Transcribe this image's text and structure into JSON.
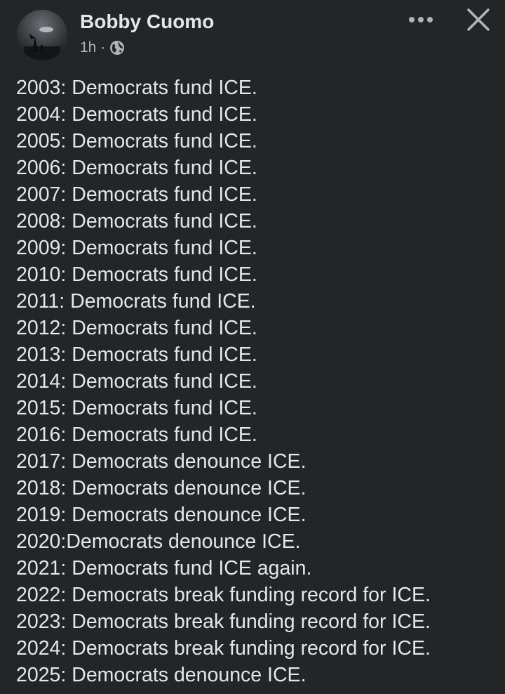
{
  "post": {
    "author": "Bobby Cuomo",
    "time": "1h",
    "separator": "·",
    "privacy_icon": "globe-icon",
    "lines": [
      "2003: Democrats fund ICE.",
      "2004: Democrats fund ICE.",
      "2005: Democrats fund ICE.",
      "2006: Democrats fund ICE.",
      "2007: Democrats fund ICE.",
      "2008: Democrats fund ICE.",
      "2009: Democrats fund ICE.",
      "2010: Democrats fund ICE.",
      "2011: Democrats fund ICE.",
      "2012: Democrats fund ICE.",
      "2013: Democrats fund ICE.",
      "2014: Democrats fund ICE.",
      "2015: Democrats fund ICE.",
      "2016: Democrats fund ICE.",
      "2017: Democrats denounce ICE.",
      "2018: Democrats denounce ICE.",
      "2019: Democrats denounce ICE.",
      "2020:Democrats denounce ICE.",
      "2021: Democrats fund ICE again.",
      "2022: Democrats break funding record for ICE.",
      "2023: Democrats break funding record for ICE.",
      "2024: Democrats break funding record for ICE.",
      "2025: Democrats denounce ICE."
    ]
  },
  "icons": {
    "more": "more-options-icon",
    "close": "close-icon"
  },
  "colors": {
    "background": "#242526",
    "primary_text": "#e4e6eb",
    "secondary_text": "#b0b3b8"
  }
}
